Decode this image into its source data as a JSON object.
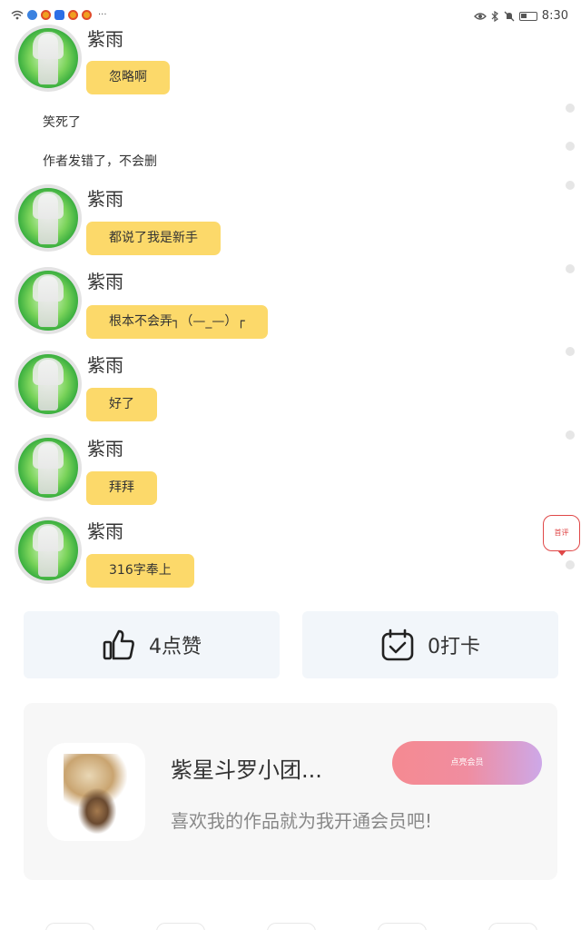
{
  "status_bar": {
    "time": "8:30",
    "more": "···",
    "icons": [
      "wifi-icon",
      "app-icon-blue",
      "weibo-icon",
      "shield-icon",
      "weibo-icon",
      "weibo-icon"
    ],
    "right_icons": [
      "eye-icon",
      "bluetooth-icon",
      "mute-icon",
      "battery-icon"
    ]
  },
  "messages": [
    {
      "name": "紫雨",
      "text": "忽略啊"
    },
    {
      "name": "紫雨",
      "text": "都说了我是新手"
    },
    {
      "name": "紫雨",
      "text": "根本不会弄┐（—_—）┌"
    },
    {
      "name": "紫雨",
      "text": "好了"
    },
    {
      "name": "紫雨",
      "text": "拜拜"
    },
    {
      "name": "紫雨",
      "text": "316字奉上"
    }
  ],
  "plain_lines": [
    "笑死了",
    "作者发错了，不会删"
  ],
  "comment_button": {
    "label": "首评"
  },
  "actions": {
    "like": {
      "label": "4点赞",
      "icon": "thumbs-up-icon"
    },
    "checkin": {
      "label": "0打卡",
      "icon": "calendar-check-icon"
    }
  },
  "author_card": {
    "title": "紫星斗罗小团...",
    "subtitle": "喜欢我的作品就为我开通会员吧!",
    "button": "点亮会员"
  },
  "colors": {
    "bubble": "#fcd96a",
    "action_bg": "#f2f6fa",
    "accent_red": "#e04848",
    "vip_gradient_start": "#f58a91",
    "vip_gradient_end": "#cda8e8"
  }
}
